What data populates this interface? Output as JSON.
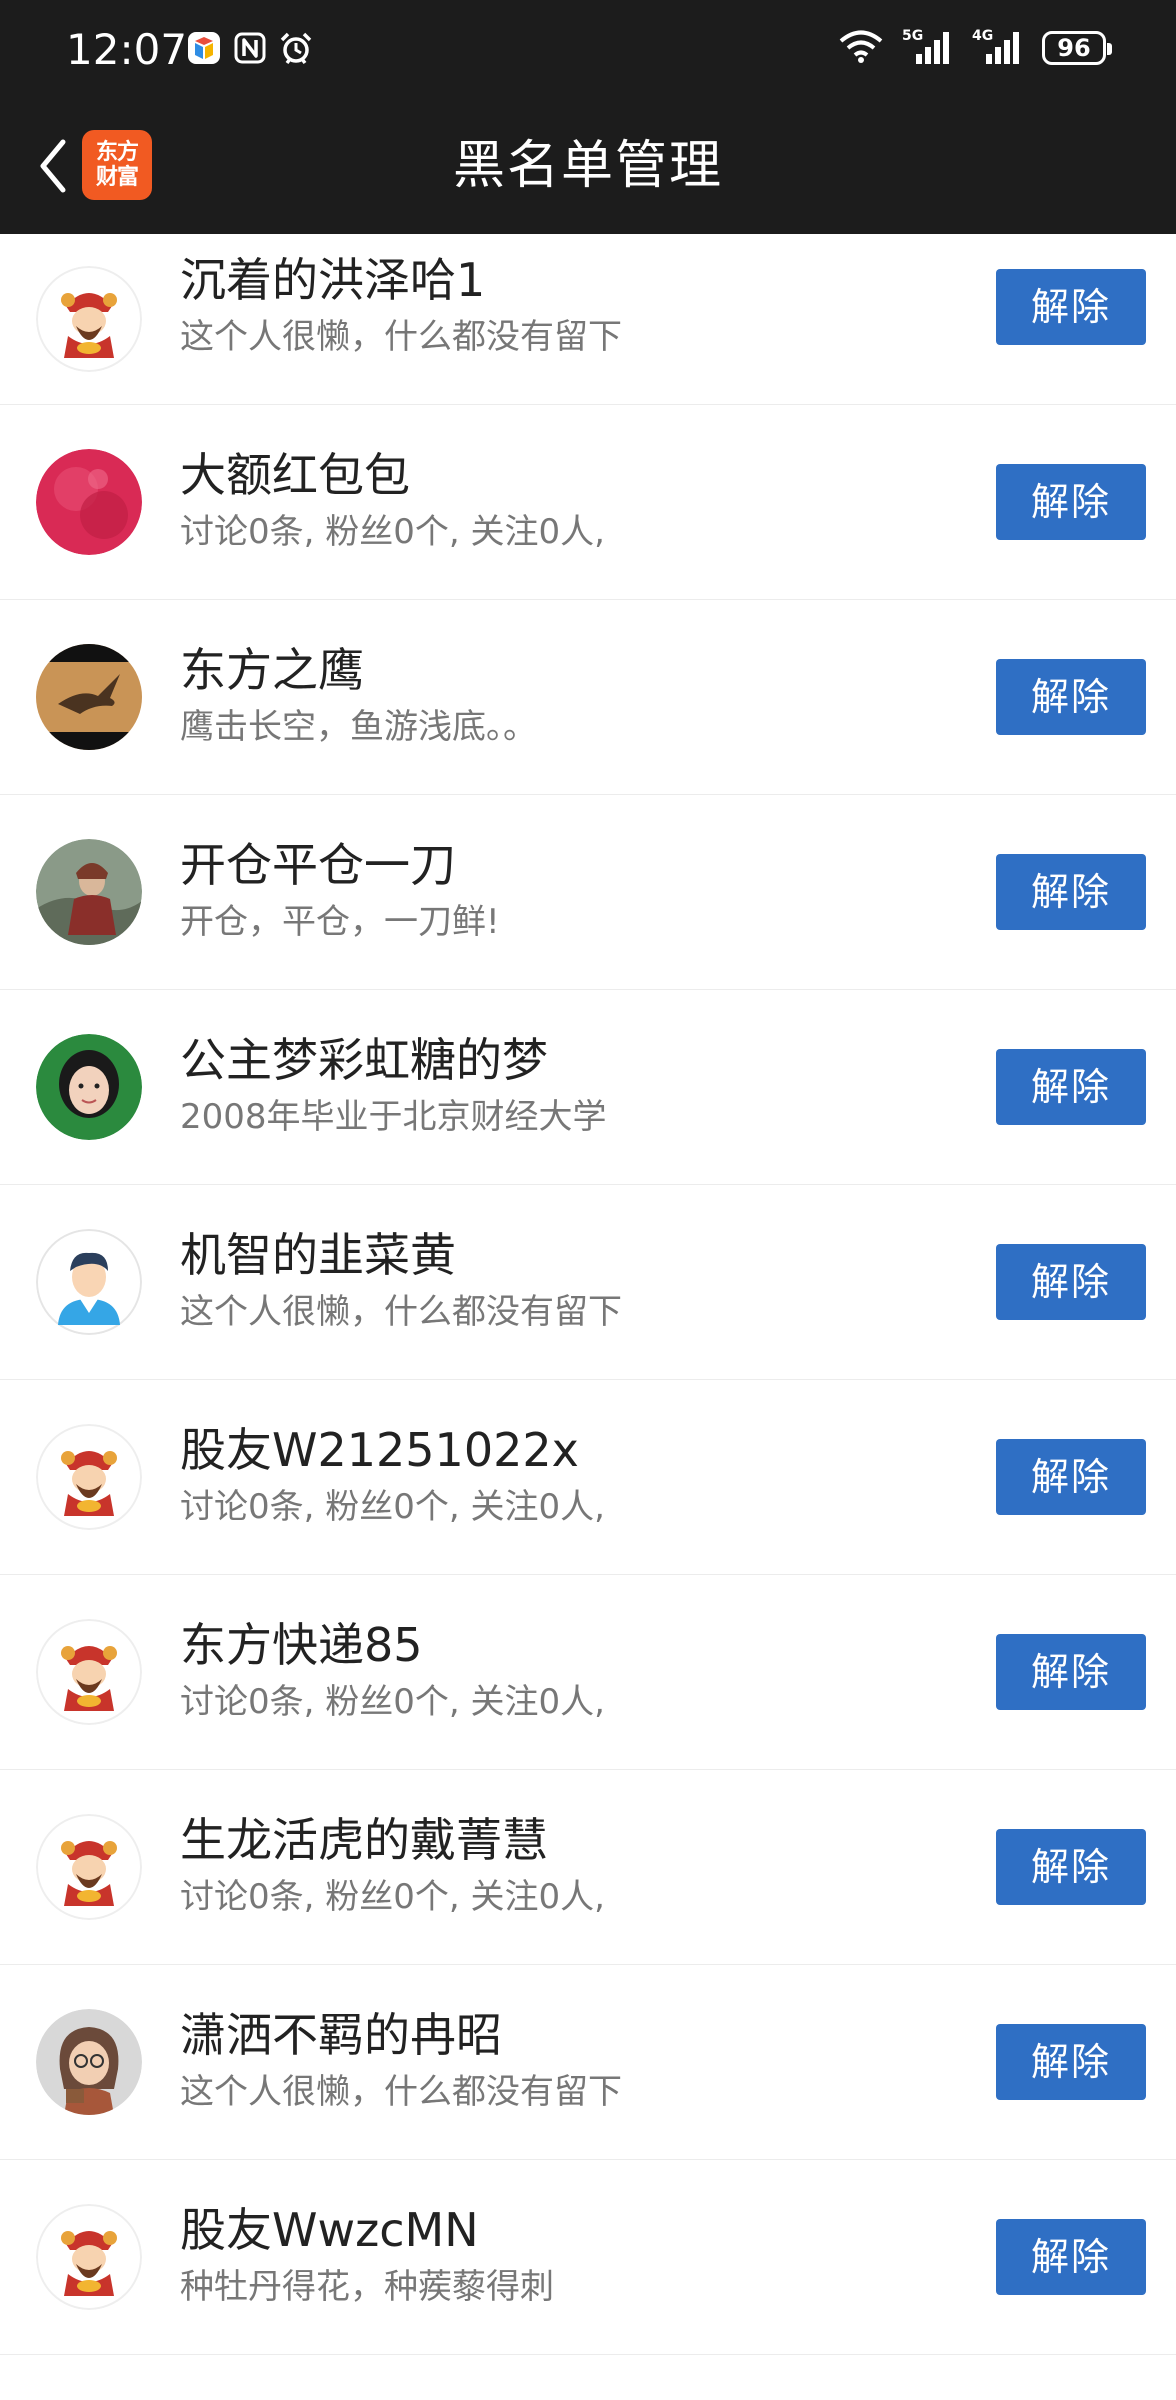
{
  "status_bar": {
    "time": "12:07",
    "battery": "96",
    "icons": [
      "app-notification-icon",
      "nfc-icon",
      "alarm-icon",
      "wifi-icon",
      "signal-5g-icon",
      "signal-4g-icon",
      "battery-icon"
    ]
  },
  "header": {
    "title": "黑名单管理",
    "logo_line1": "东方",
    "logo_line2": "财富",
    "back_icon": "chevron-left-icon"
  },
  "colors": {
    "bar_background": "#1c1c1c",
    "button": "#2f6fc4",
    "logo": "#f15a22"
  },
  "blacklist": [
    {
      "name": "沉着的洪泽哈1",
      "bio": "这个人很懒，什么都没有留下",
      "avatar": "fortune-god-avatar",
      "action": "解除"
    },
    {
      "name": "大额红包包",
      "bio": "讨论0条, 粉丝0个, 关注0人,",
      "avatar": "red-texture-avatar",
      "action": "解除"
    },
    {
      "name": "东方之鹰",
      "bio": "鹰击长空，鱼游浅底。。",
      "avatar": "eagle-avatar",
      "action": "解除"
    },
    {
      "name": "开仓平仓一刀",
      "bio": "开仓，平仓，一刀鲜!",
      "avatar": "warrior-avatar",
      "action": "解除"
    },
    {
      "name": "公主梦彩虹糖的梦",
      "bio": "2008年毕业于北京财经大学",
      "avatar": "girl-photo-avatar",
      "action": "解除"
    },
    {
      "name": "机智的韭菜黄",
      "bio": "这个人很懒，什么都没有留下",
      "avatar": "default-man-avatar",
      "action": "解除"
    },
    {
      "name": "股友W21251022x",
      "bio": "讨论0条, 粉丝0个, 关注0人,",
      "avatar": "fortune-god-avatar",
      "action": "解除"
    },
    {
      "name": "东方快递85",
      "bio": "讨论0条, 粉丝0个, 关注0人,",
      "avatar": "fortune-god-avatar",
      "action": "解除"
    },
    {
      "name": "生龙活虎的戴菁慧",
      "bio": "讨论0条, 粉丝0个, 关注0人,",
      "avatar": "fortune-god-avatar",
      "action": "解除"
    },
    {
      "name": "潇洒不羁的冉昭",
      "bio": "这个人很懒，什么都没有留下",
      "avatar": "cartoon-girl-avatar",
      "action": "解除"
    },
    {
      "name": "股友WwzcMN",
      "bio": "种牡丹得花，种蒺藜得刺",
      "avatar": "fortune-god-avatar",
      "action": "解除"
    }
  ]
}
